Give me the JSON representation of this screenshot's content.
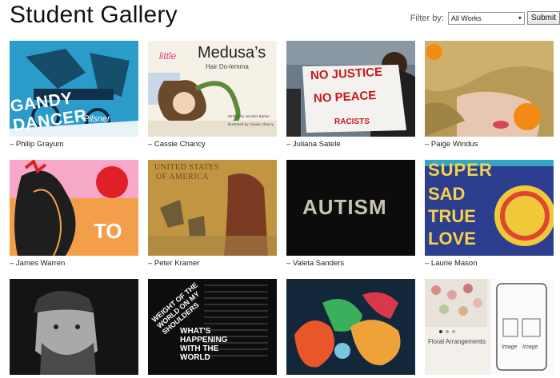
{
  "page": {
    "title": "Student Gallery"
  },
  "filter": {
    "label": "Filter by:",
    "selected": "All Works",
    "submit_label": "Submit"
  },
  "tiles": [
    {
      "caption": "– Philip Grayum",
      "art_text": [
        "GANDY DANCER",
        "Pilsner"
      ]
    },
    {
      "caption": "– Cassie Chancy",
      "art_text": [
        "little",
        "Medusa’s",
        "Hair Do-lemma",
        "Written by Jennifer Barker",
        "Illustrated by Cassie Chancy"
      ]
    },
    {
      "caption": "– Juliana Satele",
      "art_text": [
        "NO JUSTICE",
        "NO PEACE",
        "RACISTS"
      ]
    },
    {
      "caption": "– Paige Windus"
    },
    {
      "caption": "– James Warren",
      "art_text": [
        "TO"
      ]
    },
    {
      "caption": "– Peter Kramer",
      "art_text": [
        "UNITED STATES",
        "OF AMERICA"
      ]
    },
    {
      "caption": "– Valeta Sanders",
      "art_text": [
        "AUTISM"
      ]
    },
    {
      "caption": "– Laurie Mason",
      "art_text": [
        "SUPER",
        "SAD",
        "TRUE",
        "LOVE"
      ]
    },
    {
      "caption": ""
    },
    {
      "caption": "",
      "art_text": [
        "WEIGHT OF THE WORLD ON MY SHOULDERS",
        "WHAT'S HAPPENING WITH THE WORLD"
      ]
    },
    {
      "caption": ""
    },
    {
      "caption": "",
      "art_text": [
        "Floral Arrangements"
      ]
    },
    {
      "caption": "",
      "art_text": [
        "Image",
        "Image"
      ]
    }
  ],
  "colors": {
    "accent_blue": "#2b9cc9",
    "autism_text": "#c8c1b5"
  }
}
